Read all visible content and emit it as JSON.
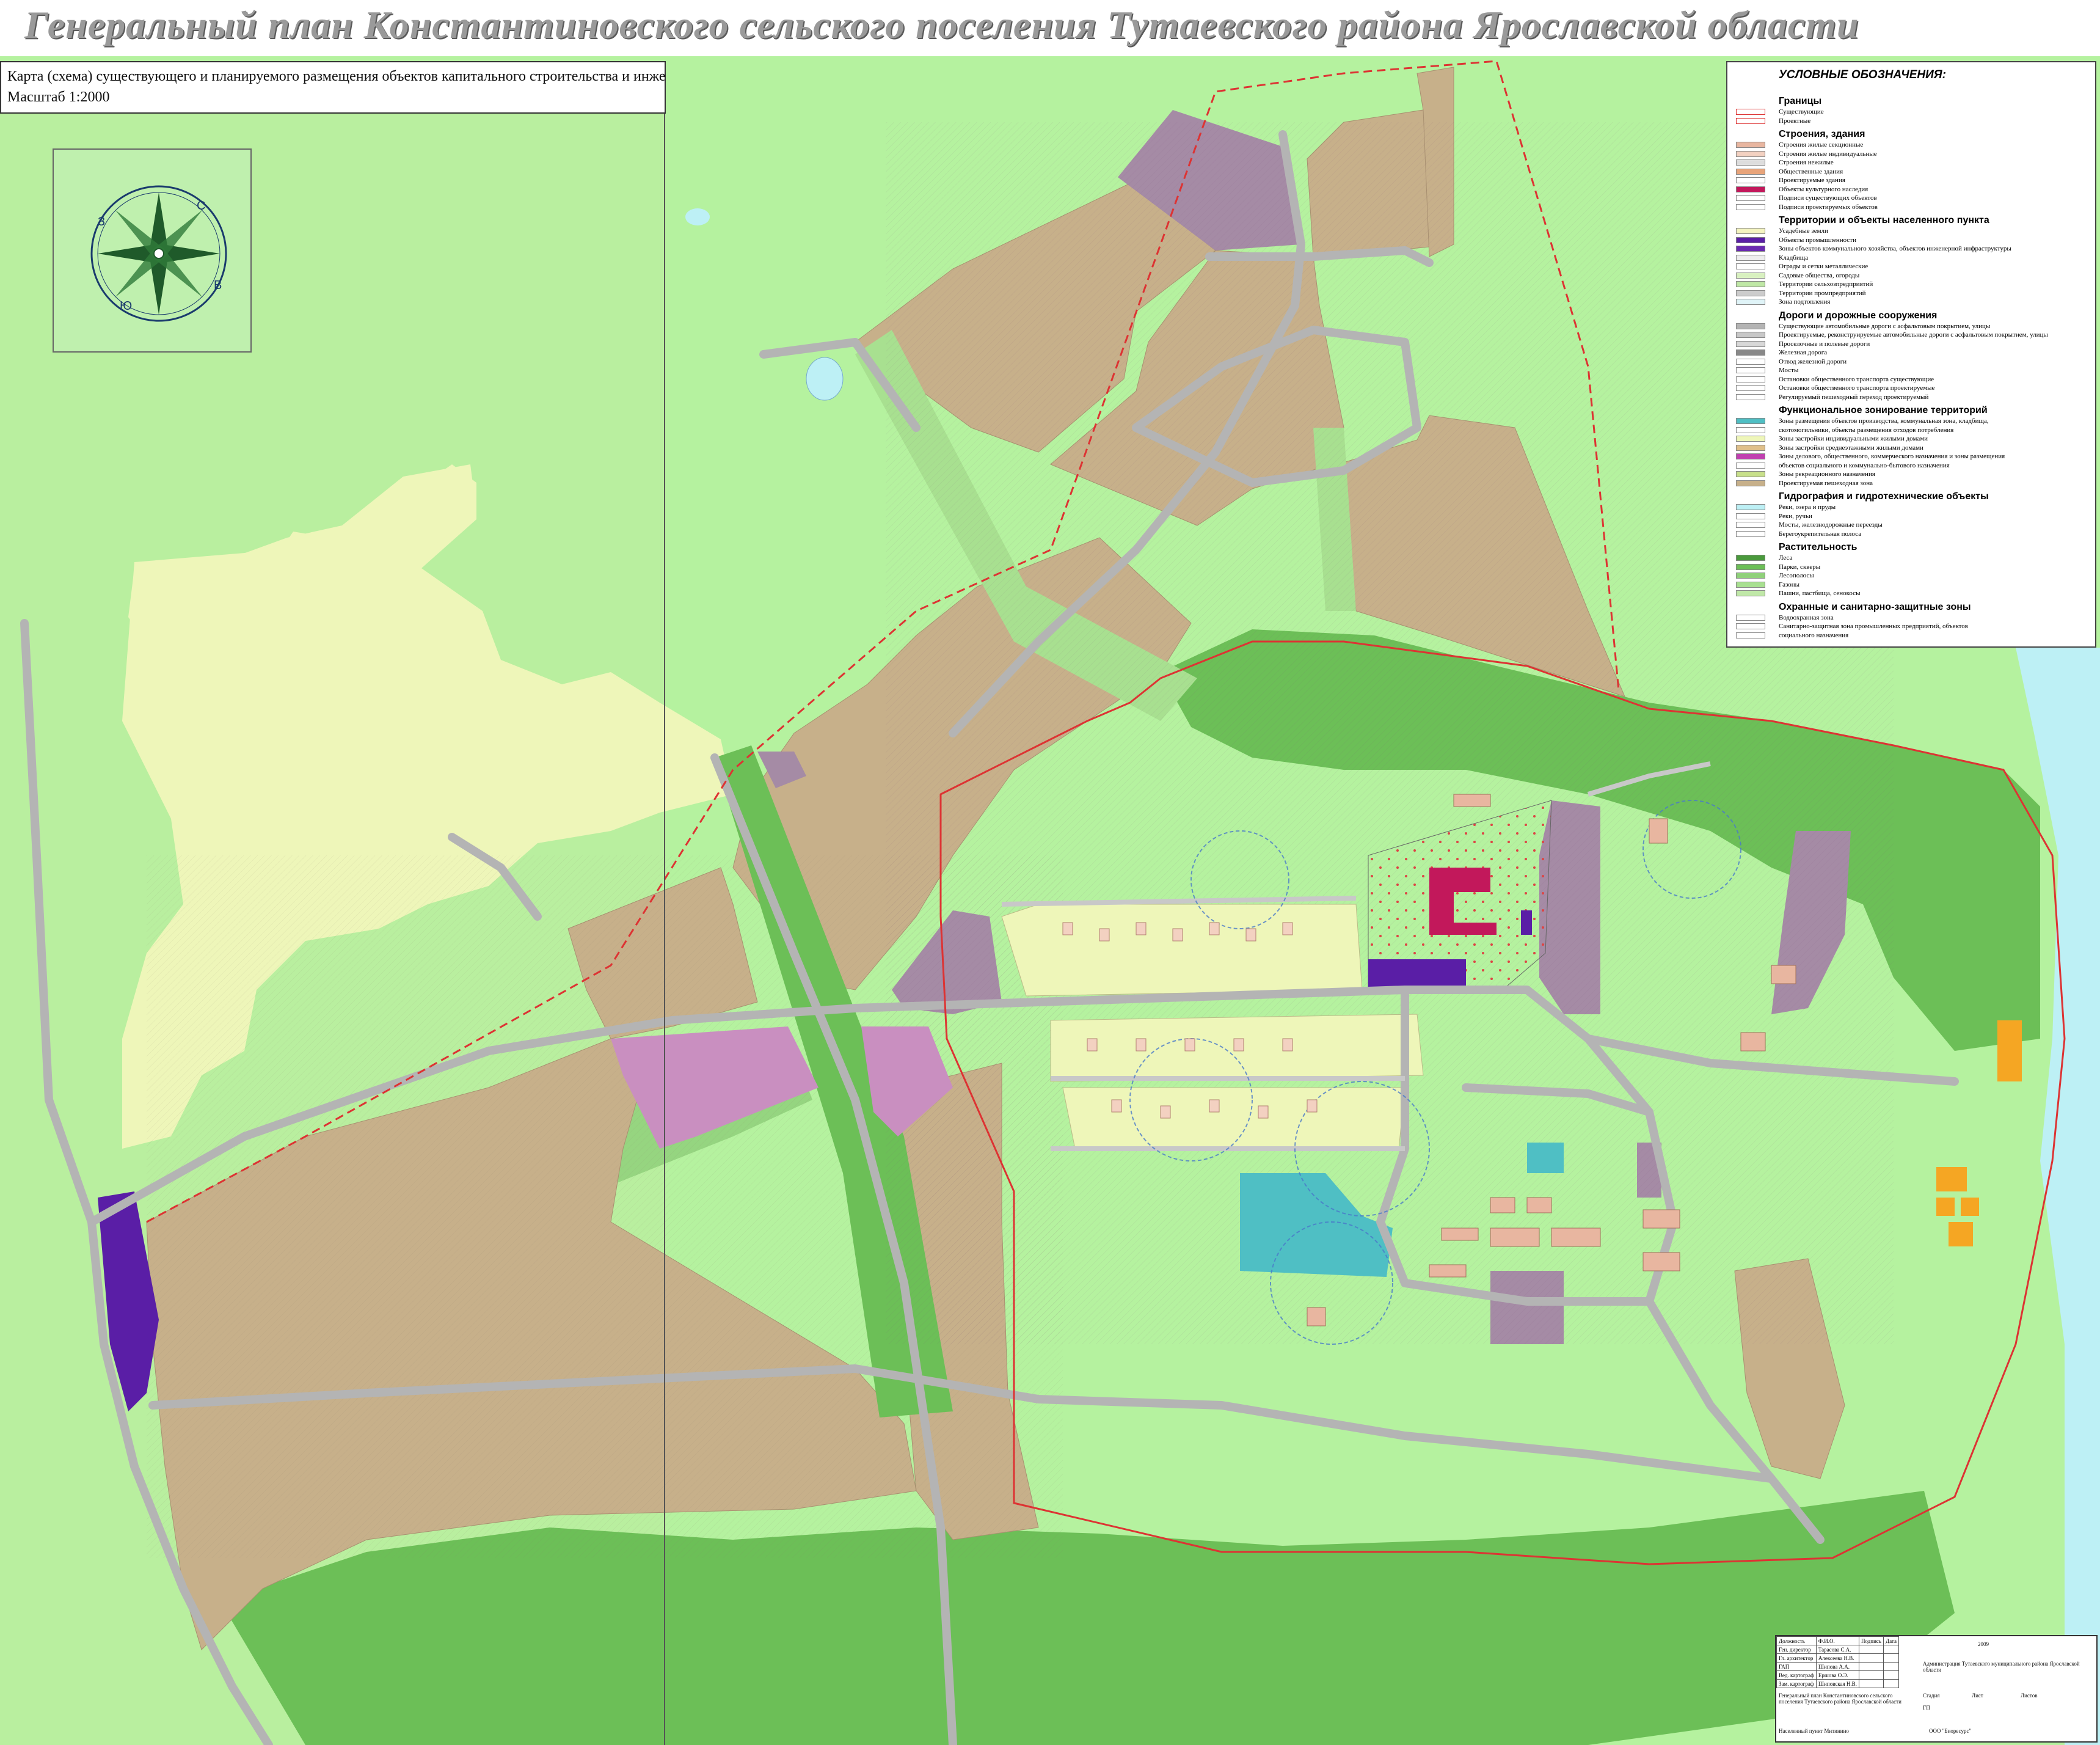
{
  "title": "Генеральный план Константиновского сельского поселения Тутаевского района Ярославской области",
  "subtitle": {
    "line1": "Карта (схема) существующего и планируемого размещения объектов капитального строительства и инженер",
    "line2": "Масштаб 1:2000"
  },
  "compass": {
    "n": "С",
    "s": "Ю",
    "e": "В",
    "w": "З"
  },
  "colors": {
    "background": "#b5f29f",
    "agri": "#c7b08a",
    "purple_zone": "#a58ba5",
    "pink_zone": "#c98fc0",
    "residential": "#eef6b9",
    "forest": "#6cbf57",
    "road": "#b4b4b4",
    "commercial_magenta": "#c2185b",
    "communal_violet": "#5a1ea6",
    "industrial_cyan": "#4fbfc4",
    "water": "#bdf0f5",
    "orange": "#f5a623"
  },
  "legend": {
    "title": "УСЛОВНЫЕ ОБОЗНАЧЕНИЯ:",
    "sections": [
      {
        "name": "Границы",
        "items": [
          {
            "label": "Существующие",
            "color": "#ffffff",
            "border": "#d33"
          },
          {
            "label": "Проектные",
            "color": "#ffffff",
            "border": "#d33"
          }
        ]
      },
      {
        "name": "Строения, здания",
        "items": [
          {
            "label": "Строения жилые секционные",
            "color": "#e8b6a0"
          },
          {
            "label": "Строения жилые индивидуальные",
            "color": "#f3d1c1"
          },
          {
            "label": "Строения нежилые",
            "color": "#dddddd"
          },
          {
            "label": "Общественные здания",
            "color": "#e8a47a"
          },
          {
            "label": "Проектируемые здания",
            "color": "#ffffff"
          },
          {
            "label": "Объекты культурного наследия",
            "color": "#c2185b"
          },
          {
            "label": "Подписи существующих объектов",
            "color": "#ffffff"
          },
          {
            "label": "Подписи проектируемых объектов",
            "color": "#ffffff"
          }
        ]
      },
      {
        "name": "Территории и объекты населенного пункта",
        "items": [
          {
            "label": "Усадебные земли",
            "color": "#f5f5c0"
          },
          {
            "label": "Объекты промышленности",
            "color": "#5a1ea6"
          },
          {
            "label": "Зоны объектов коммунального хозяйства, объектов инженерной инфраструктуры",
            "color": "#6a2ab0"
          },
          {
            "label": "Кладбища",
            "color": "#eeeeee"
          },
          {
            "label": "Ограды и сетки металлические",
            "color": "#ffffff"
          },
          {
            "label": "Садовые общества, огороды",
            "color": "#d8f0c0"
          },
          {
            "label": "Территории сельхозпредприятий",
            "color": "#bfe8a5"
          },
          {
            "label": "Территории промпредприятий",
            "color": "#cccccc"
          },
          {
            "label": "Зона подтопления",
            "color": "#e0f4f8"
          }
        ]
      },
      {
        "name": "Дороги и дорожные сооружения",
        "items": [
          {
            "label": "Существующие автомобильные дороги с асфальтовым покрытием, улицы",
            "color": "#b4b4b4"
          },
          {
            "label": "Проектируемые, реконструируемые автомобильные дороги с асфальтовым покрытием, улицы",
            "color": "#c8c8c8"
          },
          {
            "label": "Проселочные и полевые дороги",
            "color": "#d8d8d8"
          },
          {
            "label": "Железная дорога",
            "color": "#888888"
          },
          {
            "label": "Отвод железной дороги",
            "color": "#ffffff"
          },
          {
            "label": "Мосты",
            "color": "#ffffff"
          },
          {
            "label": "Остановки общественного транспорта существующие",
            "color": "#ffffff"
          },
          {
            "label": "Остановки общественного транспорта проектируемые",
            "color": "#ffffff"
          },
          {
            "label": "Регулируемый пешеходный переход проектируемый",
            "color": "#ffffff"
          }
        ]
      },
      {
        "name": "Функциональное зонирование территорий",
        "items": [
          {
            "label": "Зоны размещения объектов производства, коммунальная зона, кладбища,",
            "color": "#4fbfc4"
          },
          {
            "label": "скотомогильники, объекты размещения отходов потребления",
            "color": "#ffffff"
          },
          {
            "label": "Зоны застройки индивидуальными жилыми домами",
            "color": "#eef6b9"
          },
          {
            "label": "Зоны застройки среднеэтажными жилыми домами",
            "color": "#e0c08a"
          },
          {
            "label": "Зоны делового, общественного, коммерческого назначения и зоны размещения",
            "color": "#c040b0"
          },
          {
            "label": "объектов социального и коммунально-бытового назначения",
            "color": "#ffffff"
          },
          {
            "label": "Зоны рекреационного назначения",
            "color": "#c8e08a"
          },
          {
            "label": "Проектируемая пешеходная зона",
            "color": "#c7b08a"
          }
        ]
      },
      {
        "name": "Гидрография и гидротехнические объекты",
        "items": [
          {
            "label": "Реки, озера и пруды",
            "color": "#bdf0f5"
          },
          {
            "label": "Реки, ручьи",
            "color": "#ffffff"
          },
          {
            "label": "Мосты, железнодорожные переезды",
            "color": "#ffffff"
          },
          {
            "label": "Берегоукрепительная полоса",
            "color": "#ffffff"
          }
        ]
      },
      {
        "name": "Растительность",
        "items": [
          {
            "label": "Леса",
            "color": "#4a9a3c"
          },
          {
            "label": "Парки, скверы",
            "color": "#6cbf57"
          },
          {
            "label": "Лесополосы",
            "color": "#8fd07a"
          },
          {
            "label": "Газоны",
            "color": "#a8e090"
          },
          {
            "label": "Пашни, пастбища, сенокосы",
            "color": "#c0e8a8"
          }
        ]
      },
      {
        "name": "Охранные и санитарно-защитные зоны",
        "items": [
          {
            "label": "Водоохранная зона",
            "color": "#ffffff"
          },
          {
            "label": "Санитарно-защитная зона промышленных предприятий, объектов",
            "color": "#ffffff"
          },
          {
            "label": "социального назначения",
            "color": "#ffffff"
          }
        ]
      }
    ]
  },
  "stamp": {
    "headers": [
      "Должность",
      "Ф.И.О.",
      "Подпись",
      "Дата"
    ],
    "rows": [
      [
        "Ген. директор",
        "Тарасова С.А."
      ],
      [
        "Гл. архитектор",
        "Алексеева Н.В."
      ],
      [
        "ГАП",
        "Шипова А.А."
      ],
      [
        "Вед. картограф",
        "Ершова О.Э."
      ],
      [
        "Зам. картограф",
        "Шиповская Н.В."
      ]
    ],
    "year": "2009",
    "client": "Администрация Тутаевского муниципального района Ярославской области",
    "project": "Генеральный план Константиновского сельского поселения Тутаевского района Ярославской области",
    "stage_labels": [
      "Стадия",
      "Лист",
      "Листов"
    ],
    "stage": "ГП",
    "section": "Населенный пункт Митинино",
    "company": "ООО \"Биоресурс\""
  }
}
